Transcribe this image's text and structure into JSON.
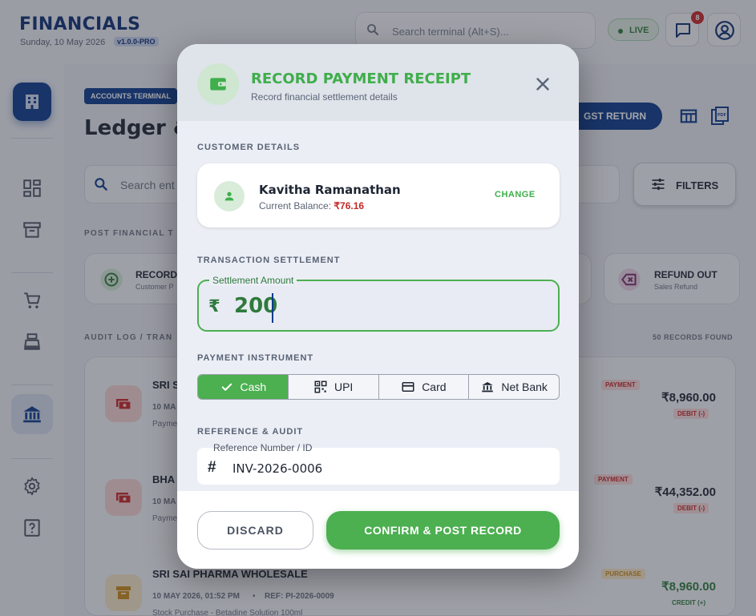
{
  "app": {
    "brand": "FINANCIALS",
    "date": "Sunday, 10 May 2026",
    "version": "v1.0.0-PRO",
    "search_placeholder": "Search terminal (Alt+S)...",
    "live_label": "LIVE",
    "notification_count": "8"
  },
  "page": {
    "tag": "ACCOUNTS TERMINAL",
    "title": "Ledger &",
    "gst_button": "GST RETURN",
    "search_placeholder": "Search ent",
    "filters_label": "FILTERS",
    "post_section": "POST FINANCIAL T",
    "record_card": {
      "title": "RECORD",
      "subtitle": "Customer P"
    },
    "refund_card": {
      "title": "REFUND OUT",
      "subtitle": "Sales Refund"
    },
    "audit_section": "AUDIT LOG / TRAN",
    "records_found": "50 RECORDS FOUND",
    "rows": [
      {
        "title": "SRI S",
        "meta": "10 MA",
        "desc": "Payme",
        "tag": "PAYMENT",
        "amount": "₹8,960.00",
        "direction": "DEBIT (-)"
      },
      {
        "title": "BHA",
        "meta": "10 MA",
        "desc": "Payme",
        "tag": "PAYMENT",
        "amount": "₹44,352.00",
        "direction": "DEBIT (-)"
      },
      {
        "title": "SRI SAI PHARMA WHOLESALE",
        "meta": "10 MAY 2026, 01:52 PM",
        "ref": "REF: PI-2026-0009",
        "desc": "Stock Purchase - Betadine Solution 100ml",
        "tag": "PURCHASE",
        "amount": "₹8,960.00",
        "direction": "CREDIT (+)"
      }
    ]
  },
  "modal": {
    "title": "RECORD PAYMENT RECEIPT",
    "subtitle": "Record financial settlement details",
    "customer_section": "CUSTOMER DETAILS",
    "customer_name": "Kavitha Ramanathan",
    "balance_label": "Current Balance: ",
    "balance_value": "₹76.16",
    "change_label": "CHANGE",
    "settlement_section": "TRANSACTION SETTLEMENT",
    "amount_label": "Settlement Amount",
    "currency_symbol": "₹",
    "amount_value": "200",
    "instrument_section": "PAYMENT INSTRUMENT",
    "instruments": [
      "Cash",
      "UPI",
      "Card",
      "Net Bank"
    ],
    "selected_instrument": "Cash",
    "reference_section": "REFERENCE & AUDIT",
    "reference_label": "Reference Number / ID",
    "reference_value": "INV-2026-0006",
    "discard_label": "DISCARD",
    "confirm_label": "CONFIRM & POST RECORD"
  },
  "colors": {
    "brand_navy": "#0d3b8c",
    "accent_green": "#4caf50",
    "danger_red": "#c62828",
    "purchase_orange": "#e6a23c"
  }
}
